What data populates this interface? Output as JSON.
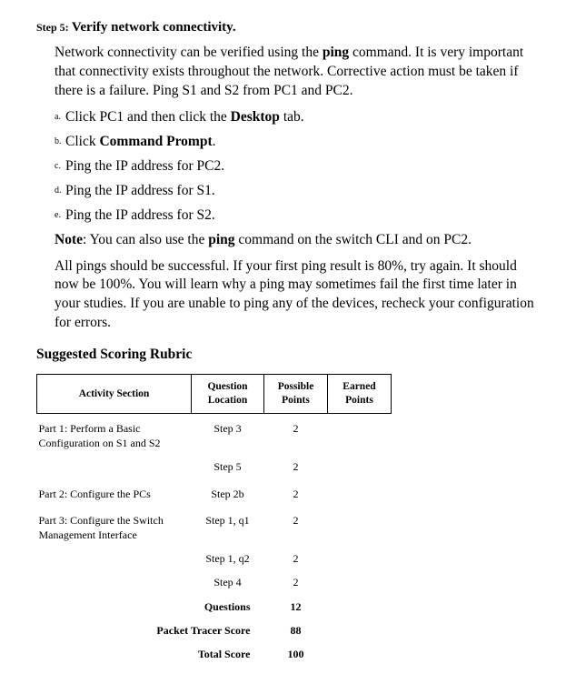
{
  "step": {
    "label": "Step 5:",
    "title": "Verify network connectivity."
  },
  "intro": {
    "p1a": "Network connectivity can be verified using the ",
    "p1b": "ping",
    "p1c": " command. It is very important that connectivity exists throughout the network. Corrective action must be taken if there is a failure. Ping S1 and S2 from PC1 and PC2."
  },
  "substeps": {
    "a": {
      "letter": "a.",
      "pre": "Click PC1 and then click the ",
      "bold": "Desktop",
      "post": " tab."
    },
    "b": {
      "letter": "b.",
      "pre": "Click ",
      "bold": "Command Prompt",
      "post": "."
    },
    "c": {
      "letter": "c.",
      "text": "Ping the IP address for PC2."
    },
    "d": {
      "letter": "d.",
      "text": "Ping the IP address for S1."
    },
    "e": {
      "letter": "e.",
      "text": "Ping the IP address for S2."
    }
  },
  "note": {
    "label": "Note",
    "p1a": ": You can also use the ",
    "p1b": "ping",
    "p1c": " command on the switch CLI and on PC2."
  },
  "closing": "All pings should be successful. If your first ping result is 80%, try again. It should now be 100%. You will learn why a ping may sometimes fail the first time later in your studies. If you are unable to ping any of the devices, recheck your configuration for errors.",
  "rubric": {
    "heading": "Suggested Scoring Rubric",
    "headers": {
      "activity": "Activity Section",
      "question1": "Question",
      "question2": "Location",
      "possible1": "Possible",
      "possible2": "Points",
      "earned1": "Earned",
      "earned2": "Points"
    },
    "rows": [
      {
        "section": "Part 1: Perform a Basic Configuration on S1 and S2",
        "location": "Step 3",
        "points": "2"
      },
      {
        "section": "",
        "location": "Step 5",
        "points": "2"
      },
      {
        "section": "Part 2: Configure the PCs",
        "location": "Step 2b",
        "points": "2"
      },
      {
        "section": "Part 3: Configure the Switch Management Interface",
        "location": "Step 1, q1",
        "points": "2"
      },
      {
        "section": "",
        "location": "Step 1, q2",
        "points": "2"
      },
      {
        "section": "",
        "location": "Step 4",
        "points": "2"
      }
    ],
    "summary": [
      {
        "label": "Questions",
        "points": "12"
      },
      {
        "label": "Packet Tracer Score",
        "points": "88"
      },
      {
        "label": "Total Score",
        "points": "100"
      }
    ]
  }
}
